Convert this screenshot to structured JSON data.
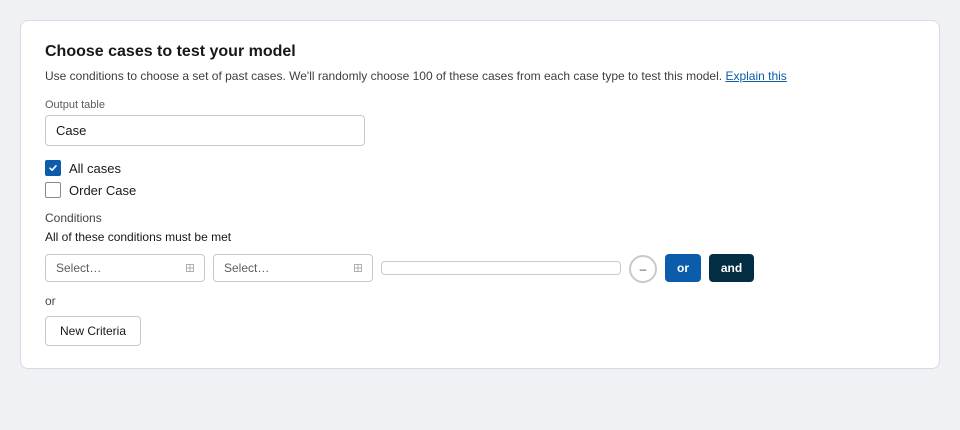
{
  "header": {
    "title": "Choose cases to test your model",
    "description": "Use conditions to choose a set of past cases. We'll randomly choose 100 of these cases from each case type to test this model.",
    "explain_link": "Explain this"
  },
  "output_table": {
    "label": "Output table",
    "value": "Case"
  },
  "case_types": [
    {
      "label": "All cases",
      "checked": true
    },
    {
      "label": "Order Case",
      "checked": false
    }
  ],
  "conditions": {
    "title": "Conditions",
    "subtitle": "All of these conditions must be met",
    "row": {
      "field_select": "Select…",
      "operator_select": "Select…",
      "value": "",
      "select_icon": "grid-icon",
      "remove_symbol": "–",
      "or_label": "or",
      "and_label": "and"
    },
    "separator": "or",
    "new_criteria_label": "New Criteria"
  },
  "colors": {
    "accent": "#0b5cab",
    "dark_button": "#032d42",
    "background": "#f0f1f5"
  }
}
